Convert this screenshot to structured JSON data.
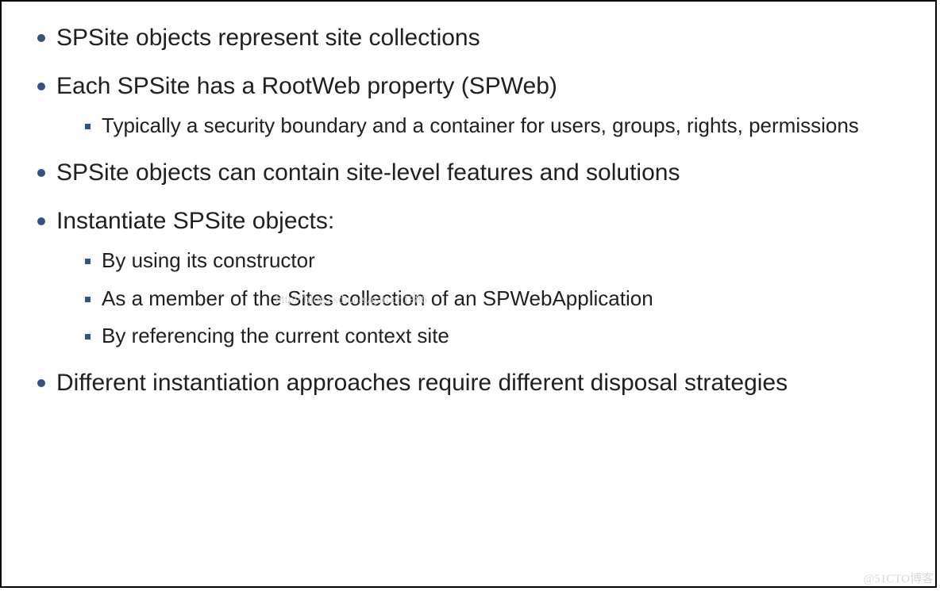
{
  "bullets": {
    "b1": "SPSite objects represent site collections",
    "b2": "Each SPSite has a RootWeb property (SPWeb)",
    "b2s1": "Typically a security boundary and a container for users, groups, rights, permissions",
    "b3": "SPSite objects can contain site-level features and solutions",
    "b4": "Instantiate SPSite objects:",
    "b4s1": "By using its constructor",
    "b4s2": "As a member of the Sites collection of an SPWebApplication",
    "b4s3": "By referencing the current context site",
    "b5": "Different instantiation approaches require different disposal strategies"
  },
  "watermarks": {
    "center": "http://blog.csdn.net/garcon1986",
    "corner": "@51CTO博客"
  }
}
